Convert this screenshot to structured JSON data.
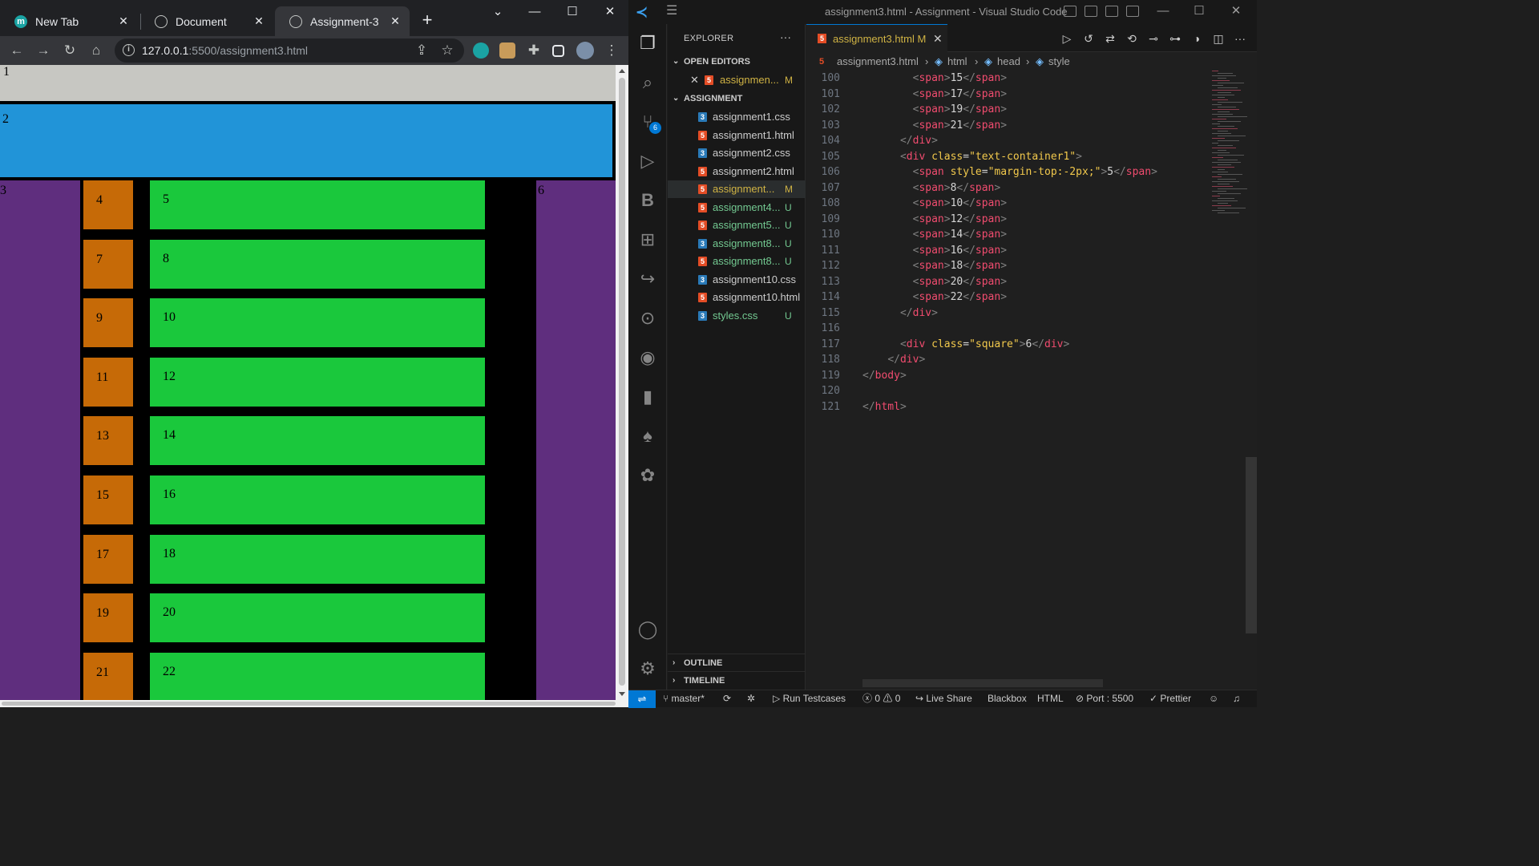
{
  "browser": {
    "tabs": [
      {
        "title": "New Tab"
      },
      {
        "title": "Document"
      },
      {
        "title": "Assignment-3"
      }
    ],
    "url_host": "127.0.0.1",
    "url_rest": ":5500/assignment3.html",
    "page": {
      "box1": "1",
      "box2": "2",
      "box3": "3",
      "box6": "6",
      "rows": [
        {
          "left": "4",
          "right": "5"
        },
        {
          "left": "7",
          "right": "8"
        },
        {
          "left": "9",
          "right": "10"
        },
        {
          "left": "11",
          "right": "12"
        },
        {
          "left": "13",
          "right": "14"
        },
        {
          "left": "15",
          "right": "16"
        },
        {
          "left": "17",
          "right": "18"
        },
        {
          "left": "19",
          "right": "20"
        },
        {
          "left": "21",
          "right": "22"
        }
      ]
    }
  },
  "vscode": {
    "title": "assignment3.html - Assignment - Visual Studio Code",
    "explorer_label": "EXPLORER",
    "open_editors_label": "OPEN EDITORS",
    "open_editor": {
      "name": "assignmen...",
      "status": "M"
    },
    "folder_label": "ASSIGNMENT",
    "files": [
      {
        "name": "assignment1.css",
        "type": "css",
        "status": ""
      },
      {
        "name": "assignment1.html",
        "type": "html",
        "status": ""
      },
      {
        "name": "assignment2.css",
        "type": "css",
        "status": ""
      },
      {
        "name": "assignment2.html",
        "type": "html",
        "status": ""
      },
      {
        "name": "assignment...",
        "type": "html",
        "status": "M"
      },
      {
        "name": "assignment4...",
        "type": "html",
        "status": "U"
      },
      {
        "name": "assignment5...",
        "type": "html",
        "status": "U"
      },
      {
        "name": "assignment8...",
        "type": "css",
        "status": "U"
      },
      {
        "name": "assignment8...",
        "type": "html",
        "status": "U"
      },
      {
        "name": "assignment10.css",
        "type": "css",
        "status": ""
      },
      {
        "name": "assignment10.html",
        "type": "html",
        "status": ""
      },
      {
        "name": "styles.css",
        "type": "css",
        "status": "U"
      }
    ],
    "outline_label": "OUTLINE",
    "timeline_label": "TIMELINE",
    "activity_badge": "6",
    "editor_tab": {
      "name": "assignment3.html",
      "status": "M"
    },
    "breadcrumb": [
      "assignment3.html",
      "html",
      "head",
      "style"
    ],
    "code_lines": [
      {
        "num": "100",
        "indent": 8,
        "kind": "span",
        "text": "15"
      },
      {
        "num": "101",
        "indent": 8,
        "kind": "span",
        "text": "17"
      },
      {
        "num": "102",
        "indent": 8,
        "kind": "span",
        "text": "19"
      },
      {
        "num": "103",
        "indent": 8,
        "kind": "span",
        "text": "21"
      },
      {
        "num": "104",
        "indent": 6,
        "kind": "close",
        "text": "div"
      },
      {
        "num": "105",
        "indent": 6,
        "kind": "divclass",
        "text": "text-container1",
        "inner": ""
      },
      {
        "num": "106",
        "indent": 8,
        "kind": "spanstyle",
        "text": "5",
        "style": "margin-top:-2px;"
      },
      {
        "num": "107",
        "indent": 8,
        "kind": "span",
        "text": "8"
      },
      {
        "num": "108",
        "indent": 8,
        "kind": "span",
        "text": "10"
      },
      {
        "num": "109",
        "indent": 8,
        "kind": "span",
        "text": "12"
      },
      {
        "num": "110",
        "indent": 8,
        "kind": "span",
        "text": "14"
      },
      {
        "num": "111",
        "indent": 8,
        "kind": "span",
        "text": "16"
      },
      {
        "num": "112",
        "indent": 8,
        "kind": "span",
        "text": "18"
      },
      {
        "num": "113",
        "indent": 8,
        "kind": "span",
        "text": "20"
      },
      {
        "num": "114",
        "indent": 8,
        "kind": "span",
        "text": "22"
      },
      {
        "num": "115",
        "indent": 6,
        "kind": "close",
        "text": "div"
      },
      {
        "num": "116",
        "indent": 0,
        "kind": "blank",
        "text": ""
      },
      {
        "num": "117",
        "indent": 6,
        "kind": "divclass",
        "text": "square",
        "inner": "6"
      },
      {
        "num": "118",
        "indent": 4,
        "kind": "close",
        "text": "div"
      },
      {
        "num": "119",
        "indent": 0,
        "kind": "close",
        "text": "body"
      },
      {
        "num": "120",
        "indent": 0,
        "kind": "blank",
        "text": ""
      },
      {
        "num": "121",
        "indent": 0,
        "kind": "close",
        "text": "html"
      }
    ],
    "status": {
      "branch": "master*",
      "run_testcases": "Run Testcases",
      "errors": "0",
      "warnings": "0",
      "live_share": "Live Share",
      "blackbox": "Blackbox",
      "language": "HTML",
      "port": "Port : 5500",
      "prettier": "Prettier"
    }
  }
}
